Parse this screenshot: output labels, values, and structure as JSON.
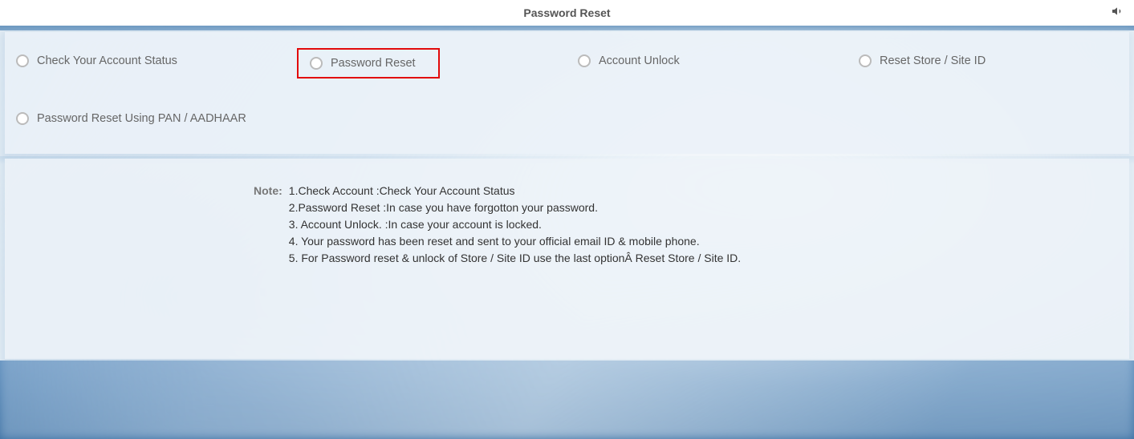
{
  "header": {
    "title": "Password Reset"
  },
  "options": {
    "check_account": "Check Your Account Status",
    "password_reset": "Password Reset",
    "account_unlock": "Account Unlock",
    "reset_store": "Reset Store / Site ID",
    "pan_aadhaar": "Password Reset Using PAN / AADHAAR"
  },
  "notes": {
    "label": "Note:",
    "lines": [
      "1.Check Account :Check Your Account Status",
      "2.Password Reset :In case you have forgotton your password.",
      "3. Account Unlock. :In case your account is locked.",
      "4. Your password has been reset and sent to your official email ID & mobile phone.",
      "5. For Password reset & unlock of Store / Site ID use the last optionÂ Reset Store / Site ID."
    ]
  }
}
